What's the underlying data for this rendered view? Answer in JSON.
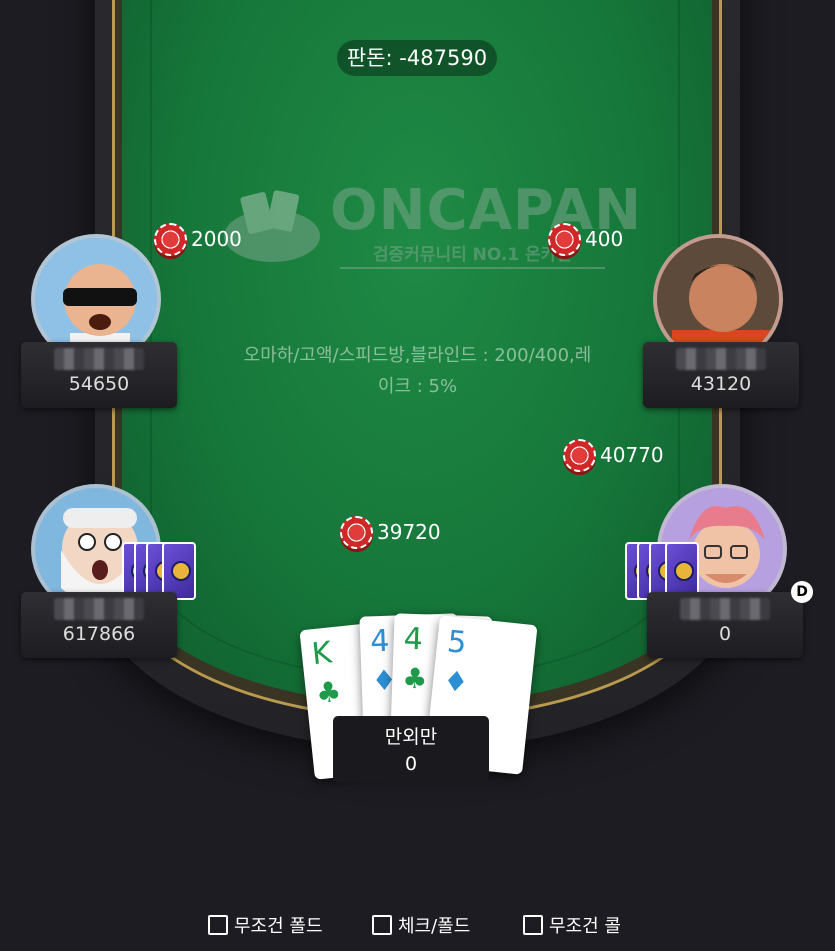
{
  "pot": {
    "label": "판돈: -487590"
  },
  "logo": {
    "main": "ONCAPAN",
    "sub": "검증커뮤니티 NO.1 온카판"
  },
  "table_info": {
    "line1": "오마하/고액/스피드방,블라인드 : 200/400,레",
    "line2": "이크 : 5%"
  },
  "players": [
    {
      "stack": "54650",
      "bet": "2000",
      "avatar": "bald-man-sunglasses-avatar"
    },
    {
      "stack": "43120",
      "bet": "400",
      "avatar": "older-man-photo-avatar"
    },
    {
      "stack": "617866",
      "bet": "39720",
      "avatar": "white-beard-man-avatar"
    },
    {
      "stack": "0",
      "bet": "40770",
      "avatar": "curly-hair-glasses-avatar",
      "dealer": "D"
    }
  ],
  "hero": {
    "name": "만외만",
    "stack": "0",
    "cards": [
      {
        "rank": "K",
        "suit": "♣",
        "color": "#1e9a4a"
      },
      {
        "rank": "4",
        "suit": "♦",
        "color": "#2c8fd6"
      },
      {
        "rank": "4",
        "suit": "♣",
        "color": "#1e9a4a"
      },
      {
        "rank": "5",
        "suit": "♦",
        "color": "#2c8fd6"
      }
    ]
  },
  "options": {
    "always_fold": "무조건 폴드",
    "check_fold": "체크/폴드",
    "always_call": "무조건 콜"
  },
  "colors": {
    "felt": "#16773a",
    "rail_trim": "#b99a4e",
    "chip": "#d02828",
    "card_back": "#4b35b5"
  }
}
